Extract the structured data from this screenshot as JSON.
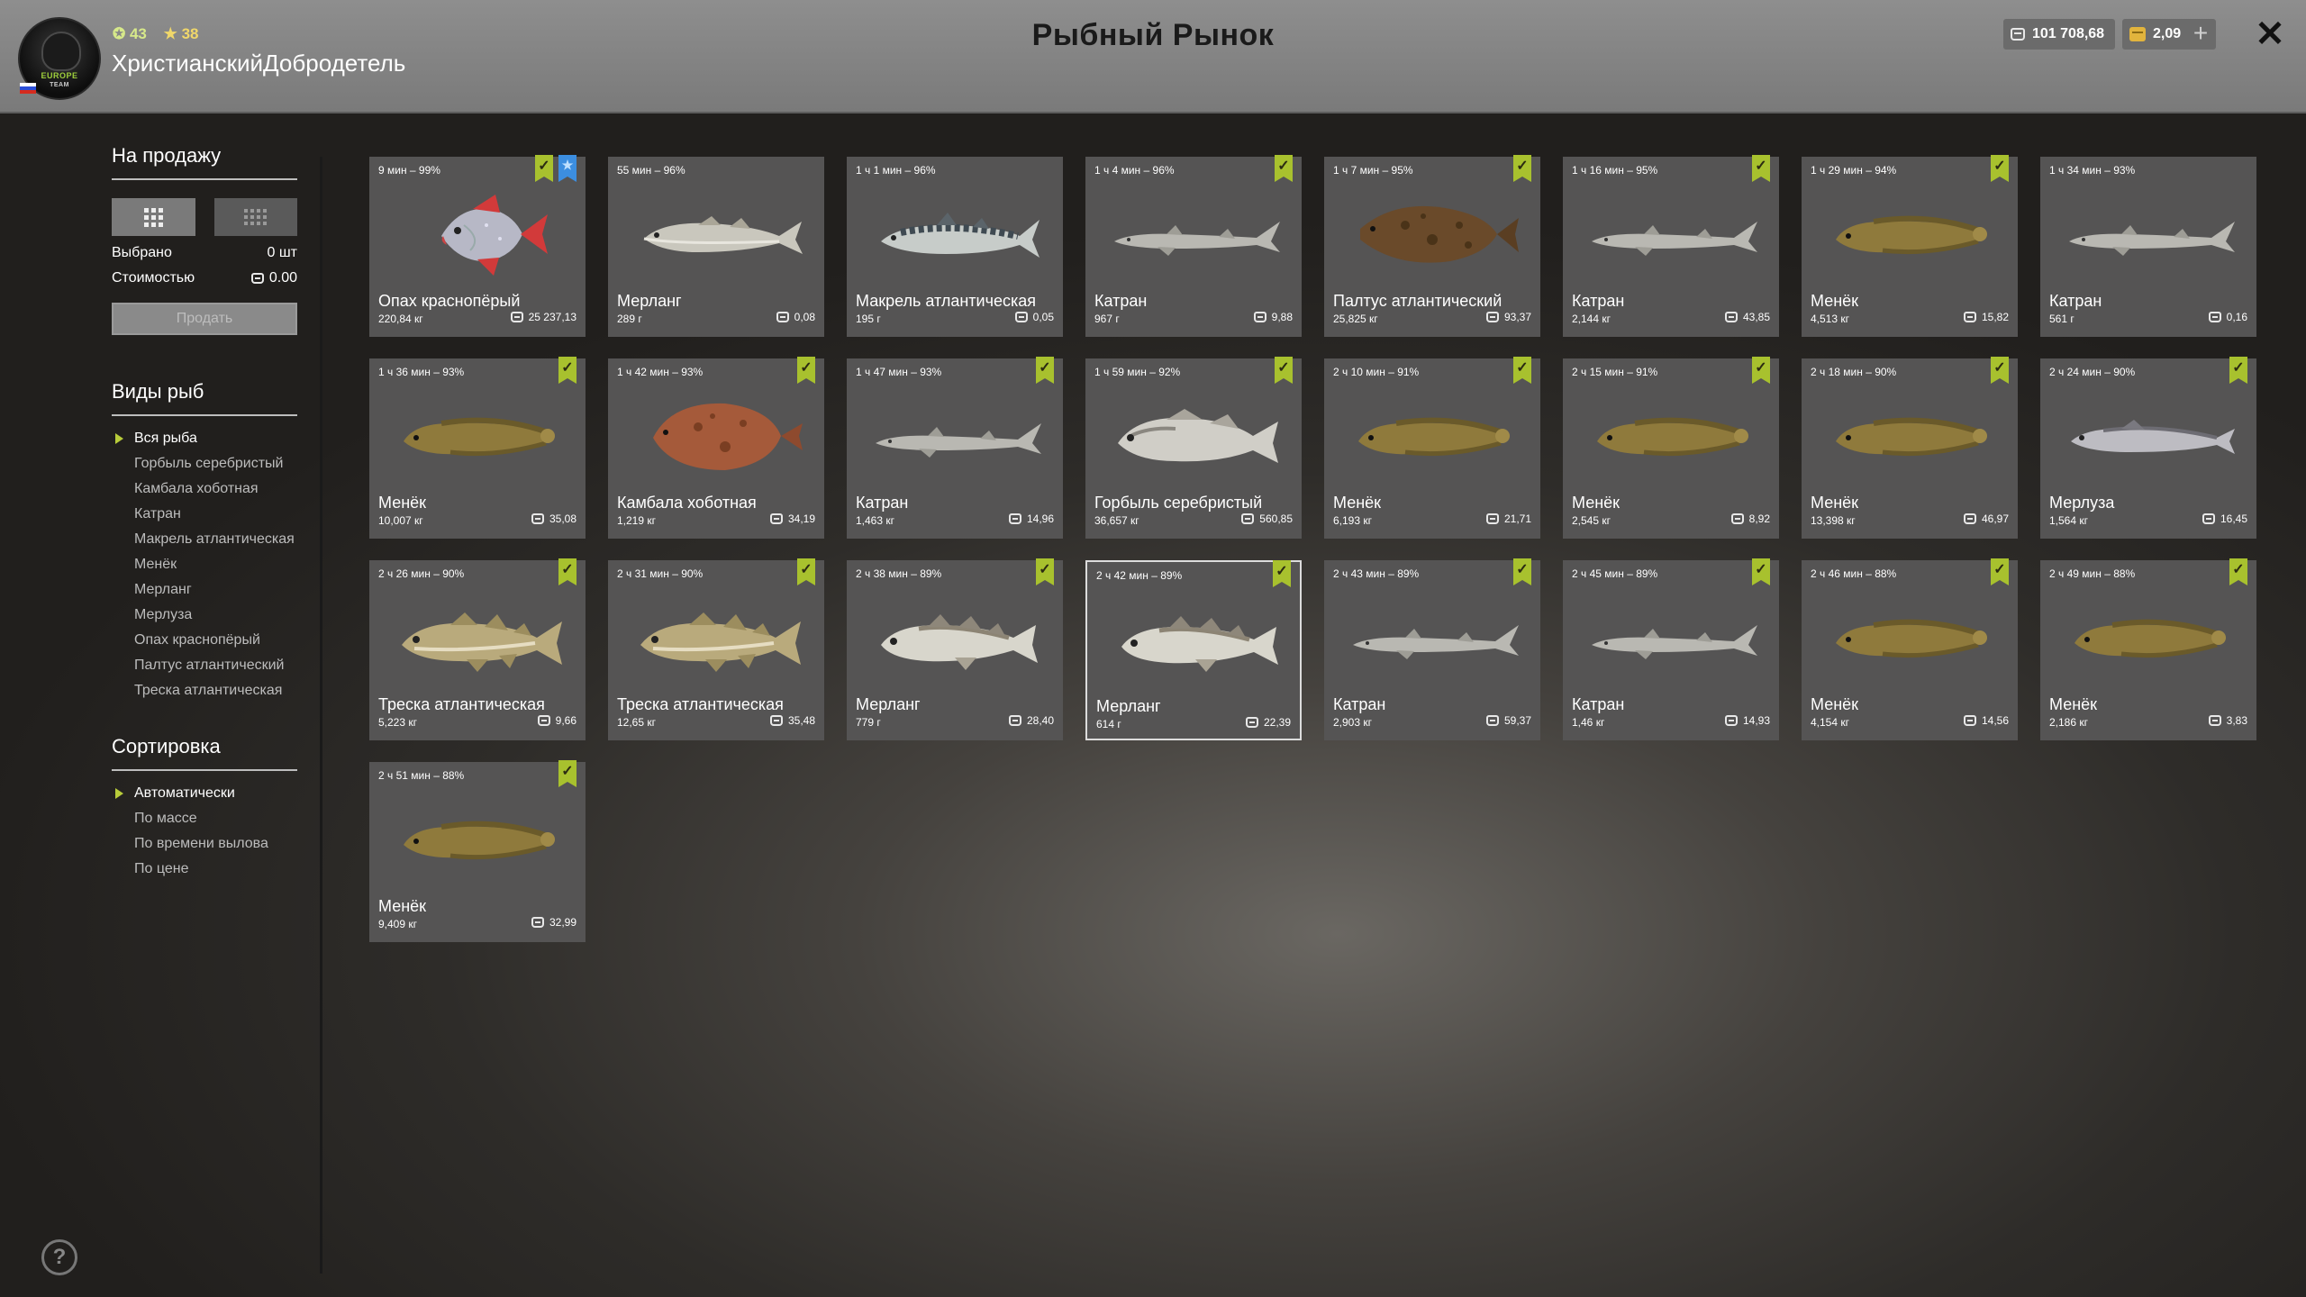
{
  "header": {
    "title": "Рыбный Рынок",
    "player_name": "ХристианскийДобродетель",
    "level": "43",
    "stars": "38",
    "silver": "101 708,68",
    "gold": "2,09",
    "plus_label": "+",
    "close_label": "✕",
    "avatar_text": "EUROPE",
    "avatar_text2": "TEAM"
  },
  "sidebar": {
    "for_sale_title": "На продажу",
    "selected_label": "Выбрано",
    "selected_value": "0 шт",
    "cost_label": "Стоимостью",
    "cost_value": "0.00",
    "sell_button": "Продать",
    "species_title": "Виды рыб",
    "species": [
      "Вся рыба",
      "Горбыль серебристый",
      "Камбала хоботная",
      "Катран",
      "Макрель атлантическая",
      "Менёк",
      "Мерланг",
      "Мерлуза",
      "Опах краснопёрый",
      "Палтус атлантический",
      "Треска атлантическая"
    ],
    "sort_title": "Сортировка",
    "sort_options": [
      "Автоматически",
      "По массе",
      "По времени вылова",
      "По цене"
    ]
  },
  "help_label": "?",
  "fish": [
    {
      "time": "9 мин – 99%",
      "name": "Опах краснопёрый",
      "weight": "220,84 кг",
      "price": "25 237,13",
      "kind": "opah",
      "green": true,
      "blue": true
    },
    {
      "time": "55 мин – 96%",
      "name": "Мерланг",
      "weight": "289 г",
      "price": "0,08",
      "kind": "whiting",
      "green": false
    },
    {
      "time": "1 ч 1 мин – 96%",
      "name": "Макрель атлантическая",
      "weight": "195 г",
      "price": "0,05",
      "kind": "mackerel",
      "green": false
    },
    {
      "time": "1 ч 4 мин – 96%",
      "name": "Катран",
      "weight": "967 г",
      "price": "9,88",
      "kind": "shark",
      "green": true
    },
    {
      "time": "1 ч 7 мин – 95%",
      "name": "Палтус атлантический",
      "weight": "25,825 кг",
      "price": "93,37",
      "kind": "halibut",
      "green": true
    },
    {
      "time": "1 ч 16 мин – 95%",
      "name": "Катран",
      "weight": "2,144 кг",
      "price": "43,85",
      "kind": "shark",
      "green": true
    },
    {
      "time": "1 ч 29 мин – 94%",
      "name": "Менёк",
      "weight": "4,513 кг",
      "price": "15,82",
      "kind": "tusk",
      "green": true
    },
    {
      "time": "1 ч 34 мин – 93%",
      "name": "Катран",
      "weight": "561 г",
      "price": "0,16",
      "kind": "shark",
      "green": false
    },
    {
      "time": "1 ч 36 мин – 93%",
      "name": "Менёк",
      "weight": "10,007 кг",
      "price": "35,08",
      "kind": "tusk",
      "green": true
    },
    {
      "time": "1 ч 42 мин – 93%",
      "name": "Камбала хоботная",
      "weight": "1,219 кг",
      "price": "34,19",
      "kind": "plaice",
      "green": true
    },
    {
      "time": "1 ч 47 мин – 93%",
      "name": "Катран",
      "weight": "1,463 кг",
      "price": "14,96",
      "kind": "shark",
      "green": true
    },
    {
      "time": "1 ч 59 мин – 92%",
      "name": "Горбыль серебристый",
      "weight": "36,657 кг",
      "price": "560,85",
      "kind": "meagre",
      "green": true
    },
    {
      "time": "2 ч 10 мин – 91%",
      "name": "Менёк",
      "weight": "6,193 кг",
      "price": "21,71",
      "kind": "tusk",
      "green": true
    },
    {
      "time": "2 ч 15 мин – 91%",
      "name": "Менёк",
      "weight": "2,545 кг",
      "price": "8,92",
      "kind": "tusk",
      "green": true
    },
    {
      "time": "2 ч 18 мин – 90%",
      "name": "Менёк",
      "weight": "13,398 кг",
      "price": "46,97",
      "kind": "tusk",
      "green": true
    },
    {
      "time": "2 ч 24 мин – 90%",
      "name": "Мерлуза",
      "weight": "1,564 кг",
      "price": "16,45",
      "kind": "hake",
      "green": true
    },
    {
      "time": "2 ч 26 мин – 90%",
      "name": "Треска атлантическая",
      "weight": "5,223 кг",
      "price": "9,66",
      "kind": "cod",
      "green": true
    },
    {
      "time": "2 ч 31 мин – 90%",
      "name": "Треска атлантическая",
      "weight": "12,65 кг",
      "price": "35,48",
      "kind": "cod",
      "green": true
    },
    {
      "time": "2 ч 38 мин – 89%",
      "name": "Мерланг",
      "weight": "779 г",
      "price": "28,40",
      "kind": "whiting2",
      "green": true
    },
    {
      "time": "2 ч 42 мин – 89%",
      "name": "Мерланг",
      "weight": "614 г",
      "price": "22,39",
      "kind": "whiting2",
      "green": true,
      "selected": true
    },
    {
      "time": "2 ч 43 мин – 89%",
      "name": "Катран",
      "weight": "2,903 кг",
      "price": "59,37",
      "kind": "shark",
      "green": true
    },
    {
      "time": "2 ч 45 мин – 89%",
      "name": "Катран",
      "weight": "1,46 кг",
      "price": "14,93",
      "kind": "shark",
      "green": true
    },
    {
      "time": "2 ч 46 мин – 88%",
      "name": "Менёк",
      "weight": "4,154 кг",
      "price": "14,56",
      "kind": "tusk",
      "green": true
    },
    {
      "time": "2 ч 49 мин – 88%",
      "name": "Менёк",
      "weight": "2,186 кг",
      "price": "3,83",
      "kind": "tusk",
      "green": true
    },
    {
      "time": "2 ч 51 мин – 88%",
      "name": "Менёк",
      "weight": "9,409 кг",
      "price": "32,99",
      "kind": "tusk",
      "green": true
    }
  ]
}
